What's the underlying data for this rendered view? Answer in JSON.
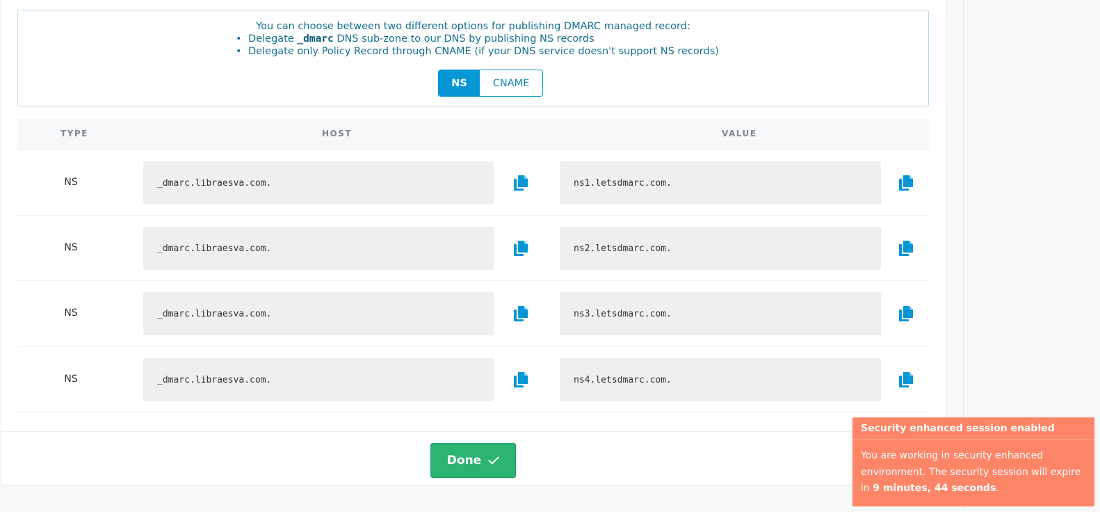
{
  "info": {
    "intro": "You can choose between two different options for publishing DMARC managed record:",
    "bullet1_pre": "Delegate ",
    "bullet1_code": "_dmarc",
    "bullet1_post": " DNS sub-zone to our DNS by publishing NS records",
    "bullet2": "Delegate only Policy Record through CNAME (if your DNS service doesn't support NS records)"
  },
  "toggle": {
    "options": [
      "NS",
      "CNAME"
    ],
    "selected": "NS"
  },
  "table": {
    "headers": {
      "type": "TYPE",
      "host": "HOST",
      "value": "VALUE"
    },
    "rows": [
      {
        "type": "NS",
        "host": "_dmarc.libraesva.com.",
        "value": "ns1.letsdmarc.com."
      },
      {
        "type": "NS",
        "host": "_dmarc.libraesva.com.",
        "value": "ns2.letsdmarc.com."
      },
      {
        "type": "NS",
        "host": "_dmarc.libraesva.com.",
        "value": "ns3.letsdmarc.com."
      },
      {
        "type": "NS",
        "host": "_dmarc.libraesva.com.",
        "value": "ns4.letsdmarc.com."
      }
    ]
  },
  "done_button": {
    "label": "Done",
    "icon": "check-icon"
  },
  "toast": {
    "title": "Security enhanced session enabled",
    "body_pre": "You are working in security enhanced environment. The security session will expire in ",
    "time": "9 minutes, 44 seconds",
    "body_post": "."
  },
  "colors": {
    "accent": "#0596d6",
    "success": "#2cb473",
    "toast": "#fd8567",
    "info_text": "#14708f"
  }
}
